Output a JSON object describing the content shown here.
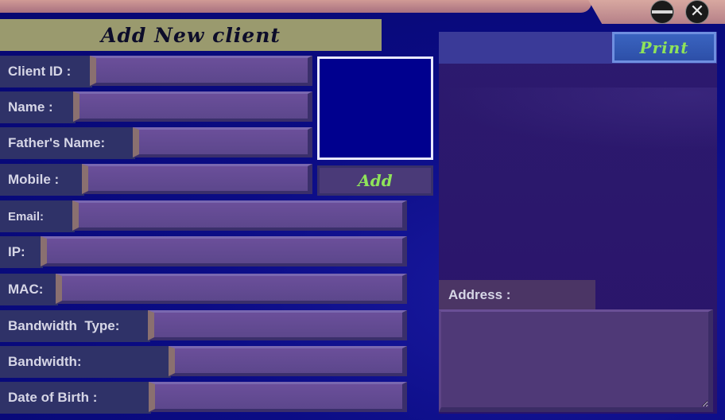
{
  "window": {
    "minimize_icon": "minus-circle-icon",
    "close_icon": "close-circle-icon"
  },
  "header": {
    "title": "Add New client"
  },
  "form": {
    "fields": [
      {
        "label": "Client ID :",
        "value": ""
      },
      {
        "label": "Name :",
        "value": ""
      },
      {
        "label": "Father's Name:",
        "value": ""
      },
      {
        "label": "Mobile :",
        "value": ""
      },
      {
        "label": "Email:",
        "value": ""
      },
      {
        "label": "IP:",
        "value": ""
      },
      {
        "label": "MAC:",
        "value": ""
      },
      {
        "label": "Bandwidth  Type:",
        "value": ""
      },
      {
        "label": "Bandwidth:",
        "value": ""
      },
      {
        "label": "Date of Birth :",
        "value": ""
      }
    ],
    "address_label": "Address :",
    "address_value": ""
  },
  "actions": {
    "add_label": "Add",
    "print_label": "Print"
  },
  "colors": {
    "background": "#0a0c82",
    "accent_green": "#8fe35a",
    "header_band": "#9a9a6e"
  }
}
